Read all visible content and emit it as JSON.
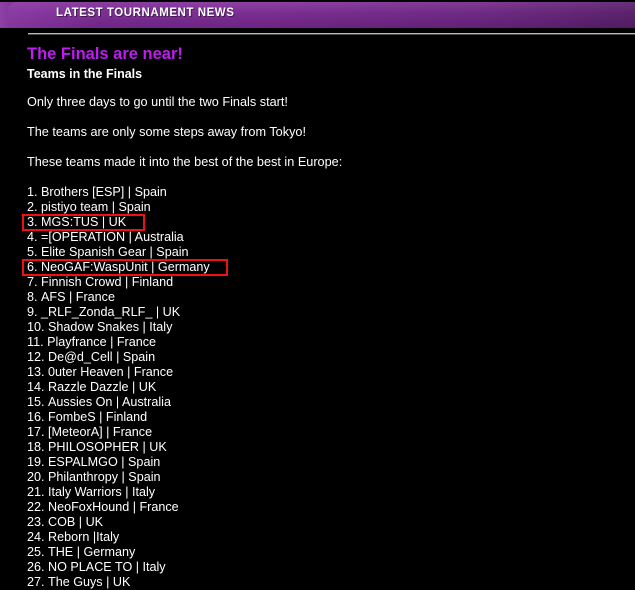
{
  "header": {
    "title": "LATEST TOURNAMENT NEWS",
    "bar_color": "#6d2483",
    "bar_highlight_color": "#8f42a6"
  },
  "article": {
    "title": "The Finals are near!",
    "title_color": "#bf1cf0",
    "subtitle": "Teams in the Finals",
    "paragraphs": [
      "Only three days to go until the two Finals start!",
      "The teams are only some steps away from Tokyo!",
      "These teams made it into the best of the best in Europe:"
    ]
  },
  "highlight_color": "#ee1111",
  "teams": [
    {
      "index": "1.",
      "text": "Brothers [ESP] | Spain",
      "highlighted": false
    },
    {
      "index": "2.",
      "text": "pistiyo team | Spain",
      "highlighted": false
    },
    {
      "index": "3.",
      "text": "MGS:TUS | UK",
      "highlighted": true,
      "hl_width": 123
    },
    {
      "index": "4.",
      "text": "=[OPERATION | Australia",
      "highlighted": false
    },
    {
      "index": "5.",
      "text": "Elite Spanish Gear | Spain",
      "highlighted": false
    },
    {
      "index": "6.",
      "text": "NeoGAF:WaspUnit | Germany",
      "highlighted": true,
      "hl_width": 206
    },
    {
      "index": "7.",
      "text": "Finnish Crowd | Finland",
      "highlighted": false
    },
    {
      "index": "8.",
      "text": "AFS | France",
      "highlighted": false
    },
    {
      "index": "9.",
      "text": "_RLF_Zonda_RLF_ | UK",
      "highlighted": false
    },
    {
      "index": "10.",
      "text": "Shadow Snakes | Italy",
      "highlighted": false
    },
    {
      "index": "11.",
      "text": "Playfrance | France",
      "highlighted": false
    },
    {
      "index": "12.",
      "text": "De@d_Cell | Spain",
      "highlighted": false
    },
    {
      "index": "13.",
      "text": "0uter Heaven | France",
      "highlighted": false
    },
    {
      "index": "14.",
      "text": "Razzle Dazzle | UK",
      "highlighted": false
    },
    {
      "index": "15.",
      "text": "Aussies On | Australia",
      "highlighted": false
    },
    {
      "index": "16.",
      "text": "FombeS | Finland",
      "highlighted": false
    },
    {
      "index": "17.",
      "text": "[MeteorA] | France",
      "highlighted": false
    },
    {
      "index": "18.",
      "text": "PHILOSOPHER | UK",
      "highlighted": false
    },
    {
      "index": "19.",
      "text": "ESPALMGO | Spain",
      "highlighted": false
    },
    {
      "index": "20.",
      "text": "Philanthropy | Spain",
      "highlighted": false
    },
    {
      "index": "21.",
      "text": "Italy Warriors | Italy",
      "highlighted": false
    },
    {
      "index": "22.",
      "text": "NeoFoxHound | France",
      "highlighted": false
    },
    {
      "index": "23.",
      "text": "COB | UK",
      "highlighted": false
    },
    {
      "index": "24.",
      "text": "Reborn |Italy",
      "highlighted": false
    },
    {
      "index": "25.",
      "text": "THE | Germany",
      "highlighted": false
    },
    {
      "index": "26.",
      "text": "NO PLACE TO | Italy",
      "highlighted": false
    },
    {
      "index": "27.",
      "text": "The Guys | UK",
      "highlighted": false
    }
  ]
}
